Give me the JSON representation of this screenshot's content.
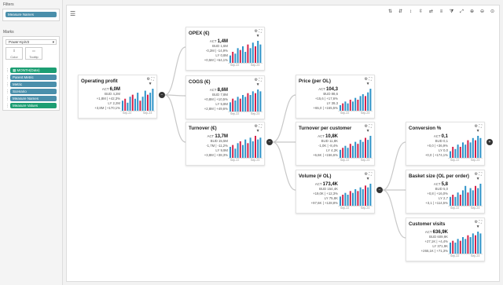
{
  "left": {
    "filters_title": "Filters",
    "filter_pill": "Measure Names",
    "marks_title": "Marks",
    "mark_type": "Power-KpiV2",
    "btn_color": "Color",
    "btn_tooltip": "Tooltip",
    "fields": [
      {
        "label": "MONTH(Date)",
        "color": "green"
      },
      {
        "label": "Parent Metric",
        "color": "blue"
      },
      {
        "label": "Metric",
        "color": "blue"
      },
      {
        "label": "Scenario",
        "color": "blue"
      },
      {
        "label": "Measure Names",
        "color": "blue"
      },
      {
        "label": "Measure Values",
        "color": "green"
      }
    ]
  },
  "colors": {
    "actual": "#d6224a",
    "budget": "#2d93c9"
  },
  "nodes": [
    {
      "id": "op",
      "title": "Operating profit",
      "act": "6,0M",
      "bud": "4,2M",
      "bud_var": "+1,8M | +42,3%",
      "bud_cls": "blu",
      "ly": "2,2M",
      "ly_var": "+3,8M | +170,1%",
      "ly_cls": "blu",
      "ax_l": "Sep-22",
      "ax_r": "Sep-23",
      "bars": [
        5,
        6,
        4,
        7,
        8,
        6,
        9,
        5,
        7,
        10,
        8,
        9,
        11
      ]
    },
    {
      "id": "opex",
      "title": "OPEX (€)",
      "act": "1,4M",
      "bud": "1,6M",
      "bud_var": "-0,2M | -14,9%",
      "bud_cls": "red",
      "ly": "0,8M",
      "ly_var": "+0,5M | +64,1%",
      "ly_cls": "blu",
      "ax_l": "Sep-22",
      "ax_r": "Sep-23",
      "bars": [
        4,
        6,
        5,
        8,
        7,
        9,
        6,
        10,
        8,
        11,
        9,
        12,
        10
      ]
    },
    {
      "id": "cogs",
      "title": "COGS (€)",
      "act": "8,6M",
      "bud": "7,8M",
      "bud_var": "+0,8M | +10,5%",
      "bud_cls": "blu",
      "ly": "5,8M",
      "ly_var": "+2,8M | +49,6%",
      "ly_cls": "blu",
      "ax_l": "Sep-22",
      "ax_r": "Sep-23",
      "bars": [
        5,
        7,
        6,
        8,
        7,
        9,
        8,
        10,
        9,
        11,
        10,
        12,
        11
      ]
    },
    {
      "id": "turn",
      "title": "Turnover (€)",
      "act": "13,7M",
      "bud": "15,5M",
      "bud_var": "-1,7M | -11,2%",
      "bud_cls": "red",
      "ly": "9,9M",
      "ly_var": "+3,8M | +38,3%",
      "ly_cls": "blu",
      "ax_l": "Sep-22",
      "ax_r": "Sep-23",
      "bars": [
        6,
        7,
        5,
        8,
        9,
        7,
        10,
        8,
        11,
        9,
        12,
        10,
        11
      ]
    },
    {
      "id": "price",
      "title": "Price (per OL)",
      "act": "104,3",
      "bud": "88,6",
      "bud_var": "+15,6 | +17,6%",
      "bud_cls": "blu",
      "ly": "39,3",
      "ly_var": "+65,0 | +165,5%",
      "ly_cls": "blu",
      "ax_l": "Sep-22",
      "ax_r": "Sep-23",
      "bars": [
        3,
        4,
        5,
        4,
        6,
        5,
        7,
        6,
        8,
        9,
        8,
        10,
        12
      ]
    },
    {
      "id": "tpc",
      "title": "Turnover per customer",
      "act": "10,8K",
      "bud": "11,8K",
      "bud_var": "-1,0K | -8,4%",
      "bud_cls": "red",
      "ly": "4,2K",
      "ly_var": "+6,6K | +156,6%",
      "ly_cls": "blu",
      "ax_l": "Sep-22",
      "ax_r": "Sep-23",
      "bars": [
        4,
        5,
        6,
        5,
        7,
        6,
        8,
        7,
        9,
        8,
        10,
        9,
        11
      ]
    },
    {
      "id": "vol",
      "title": "Volume (# OL)",
      "act": "173,4K",
      "bud": "154,4K",
      "bud_var": "+19,0K | +12,3%",
      "bud_cls": "blu",
      "ly": "75,8K",
      "ly_var": "+97,6K | +128,8%",
      "ly_cls": "blu",
      "ax_l": "Sep-22",
      "ax_r": "Sep-23",
      "bars": [
        5,
        6,
        7,
        6,
        8,
        7,
        9,
        8,
        10,
        9,
        11,
        10,
        12
      ]
    },
    {
      "id": "conv",
      "title": "Conversion %",
      "act": "0,1",
      "bud": "0,1",
      "bud_var": "+0,0 | +36,9%",
      "bud_cls": "blu",
      "ly": "0,0",
      "ly_var": "+0,0 | +174,1%",
      "ly_cls": "blu",
      "ax_l": "Sep-22",
      "ax_r": "Sep-23",
      "bars": [
        3,
        5,
        4,
        6,
        5,
        7,
        6,
        8,
        7,
        9,
        8,
        10,
        9
      ]
    },
    {
      "id": "basket",
      "title": "Basket size (OL per order)",
      "act": "5,8",
      "bud": "5,0",
      "bud_var": "+0,8 | +16,0%",
      "bud_cls": "blu",
      "ly": "2,7",
      "ly_var": "+3,1 | +114,5%",
      "ly_cls": "blu",
      "ax_l": "Sep-22",
      "ax_r": "Sep-23",
      "bars": [
        4,
        5,
        4,
        6,
        5,
        7,
        9,
        6,
        8,
        7,
        9,
        8,
        10
      ]
    },
    {
      "id": "visits",
      "title": "Customer visits",
      "act": "636,9K",
      "bud": "609,9K",
      "bud_var": "+27,1K | +4,4%",
      "bud_cls": "blu",
      "ly": "371,9K",
      "ly_var": "+265,1K | +71,3%",
      "ly_cls": "blu",
      "ax_l": "Sep-22",
      "ax_r": "Sep-23",
      "bars": [
        6,
        7,
        6,
        8,
        7,
        9,
        8,
        10,
        9,
        11,
        10,
        12,
        11
      ]
    }
  ],
  "labels": {
    "act": "ACT",
    "bud": "BUD",
    "ly": "LY"
  }
}
